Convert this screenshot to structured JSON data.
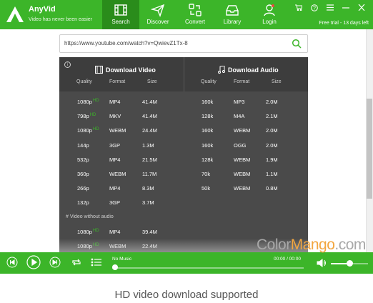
{
  "app": {
    "name": "AnyVid",
    "tagline": "Video has never been easier",
    "trial": "Free trial - 13 days left",
    "accent": "#3cb529"
  },
  "nav": [
    {
      "label": "Search",
      "icon": "film-icon",
      "active": true
    },
    {
      "label": "Discover",
      "icon": "send-icon",
      "active": false
    },
    {
      "label": "Convert",
      "icon": "convert-icon",
      "active": false
    },
    {
      "label": "Library",
      "icon": "inbox-icon",
      "active": false
    },
    {
      "label": "Login",
      "icon": "user-icon",
      "active": false
    }
  ],
  "window_controls": [
    "cart-icon",
    "help-icon",
    "menu-icon",
    "minimize-icon",
    "close-icon"
  ],
  "search": {
    "url": "https://www.youtube.com/watch?v=QwievZ1Tx-8"
  },
  "panel": {
    "video_title": "Download Video",
    "audio_title": "Download Audio",
    "headers": {
      "quality": "Quality",
      "format": "Format",
      "size": "Size"
    },
    "video_rows": [
      {
        "quality": "1080p",
        "hd": "HD",
        "format": "MP4",
        "size": "41.4M"
      },
      {
        "quality": "798p",
        "hd": "HD",
        "format": "MKV",
        "size": "41.4M"
      },
      {
        "quality": "1080p",
        "hd": "HD",
        "format": "WEBM",
        "size": "24.4M"
      },
      {
        "quality": "144p",
        "hd": "",
        "format": "3GP",
        "size": "1.3M"
      },
      {
        "quality": "532p",
        "hd": "",
        "format": "MP4",
        "size": "21.5M"
      },
      {
        "quality": "360p",
        "hd": "",
        "format": "WEBM",
        "size": "11.7M"
      },
      {
        "quality": "266p",
        "hd": "",
        "format": "MP4",
        "size": "8.3M"
      },
      {
        "quality": "132p",
        "hd": "",
        "format": "3GP",
        "size": "3.7M"
      }
    ],
    "audio_rows": [
      {
        "quality": "160k",
        "format": "MP3",
        "size": "2.0M"
      },
      {
        "quality": "128k",
        "format": "M4A",
        "size": "2.1M"
      },
      {
        "quality": "160k",
        "format": "WEBM",
        "size": "2.0M"
      },
      {
        "quality": "160k",
        "format": "OGG",
        "size": "2.0M"
      },
      {
        "quality": "128k",
        "format": "WEBM",
        "size": "1.9M"
      },
      {
        "quality": "70k",
        "format": "WEBM",
        "size": "1.1M"
      },
      {
        "quality": "50k",
        "format": "WEBM",
        "size": "0.8M"
      }
    ],
    "no_audio_label": "# Video without audio",
    "no_audio_rows": [
      {
        "quality": "1080p",
        "hd": "HD",
        "format": "MP4",
        "size": "39.4M"
      },
      {
        "quality": "1080p",
        "hd": "HD",
        "format": "WEBM",
        "size": "22.4M"
      }
    ]
  },
  "player": {
    "now_playing": "No Music",
    "time": "00:00 / 00:00",
    "progress": 0.0,
    "volume": 0.5
  },
  "watermark": {
    "part1": "Color",
    "part2": "Mango",
    "part3": ".com"
  },
  "caption": "HD video download supported"
}
